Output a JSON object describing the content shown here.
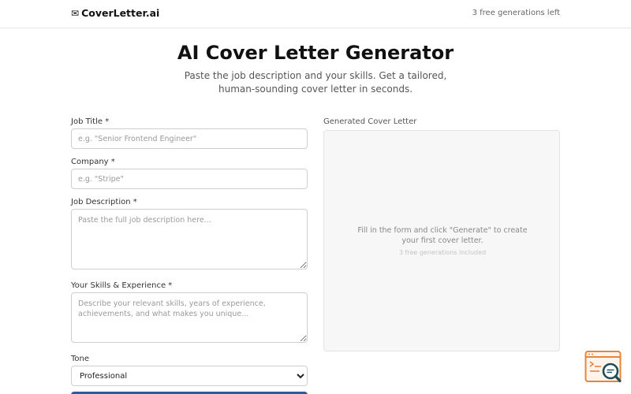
{
  "header": {
    "logo_icon": "envelope-icon",
    "logo_text": "CoverLetter.ai",
    "credits": "3 free generations left"
  },
  "hero": {
    "title": "AI Cover Letter Generator",
    "subtitle": "Paste the job description and your skills. Get a tailored, human-sounding cover letter in seconds."
  },
  "form": {
    "job_title": {
      "label": "Job Title *",
      "placeholder": "e.g. \"Senior Frontend Engineer\""
    },
    "company": {
      "label": "Company *",
      "placeholder": "e.g. \"Stripe\""
    },
    "job_description": {
      "label": "Job Description *",
      "placeholder": "Paste the full job description here..."
    },
    "skills": {
      "label": "Your Skills & Experience *",
      "placeholder": "Describe your relevant skills, years of experience, achievements, and what makes you unique..."
    },
    "tone": {
      "label": "Tone",
      "selected": "Professional"
    }
  },
  "output": {
    "label": "Generated Cover Letter",
    "empty_message": "Fill in the form and click \"Generate\" to create your first cover letter.",
    "note": "3 free generations included"
  },
  "colors": {
    "primary": "#2c5aa0",
    "fab_orange": "#e8833a",
    "fab_teal": "#1f4e5a"
  },
  "icons": {
    "floating_widget": "code-search-icon"
  }
}
